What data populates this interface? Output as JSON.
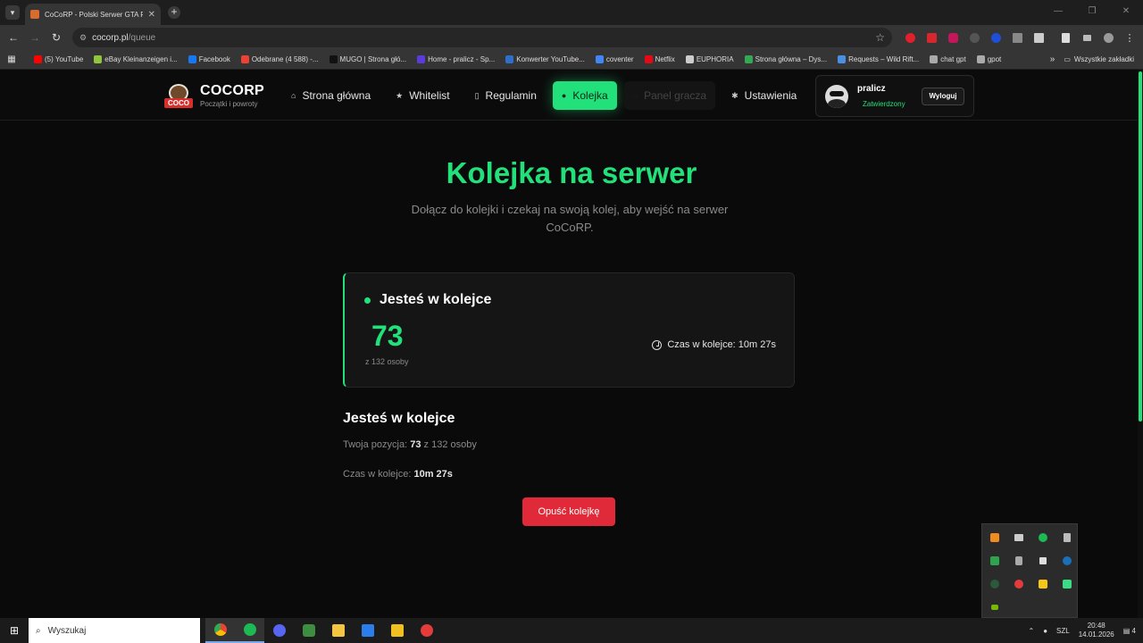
{
  "browser": {
    "tab_title": "CoCoRP - Polski Serwer GTA RP",
    "url_host": "cocorp.pl",
    "url_path": "/queue",
    "bookmarks": [
      {
        "label": "(5) YouTube",
        "color": "#ff0000"
      },
      {
        "label": "eBay Kleinanzeigen i...",
        "color": "#8ec63f"
      },
      {
        "label": "Facebook",
        "color": "#1877f2"
      },
      {
        "label": "Odebrane (4 588) -...",
        "color": "#ea4335"
      },
      {
        "label": "MUGO | Strona głó...",
        "color": "#111111"
      },
      {
        "label": "Home - pralicz - Sp...",
        "color": "#5b3bdb"
      },
      {
        "label": "Konwerter YouTube...",
        "color": "#2d6fc9"
      },
      {
        "label": "coventer",
        "color": "#4285f4"
      },
      {
        "label": "Netflix",
        "color": "#e50914"
      },
      {
        "label": "EUPHORIA",
        "color": "#cccccc"
      },
      {
        "label": "Strona główna – Dys...",
        "color": "#34a853"
      },
      {
        "label": "Requests – Wild Rift...",
        "color": "#4a90e2"
      },
      {
        "label": "chat gpt",
        "color": "#aaaaaa"
      },
      {
        "label": "gpot",
        "color": "#aaaaaa"
      }
    ],
    "all_bookmarks": "Wszystkie zakładki"
  },
  "brand": {
    "name": "COCORP",
    "tagline": "Początki i powroty",
    "logo_text": "COCO",
    "accent": "#22e07a"
  },
  "nav": {
    "items": [
      {
        "label": "Strona główna",
        "icon": "home-icon"
      },
      {
        "label": "Whitelist",
        "icon": "star-icon"
      },
      {
        "label": "Regulamin",
        "icon": "document-icon"
      },
      {
        "label": "Kolejka",
        "icon": "user-icon",
        "active": true
      },
      {
        "label": "Panel gracza",
        "icon": "loader-icon",
        "disabled": true
      },
      {
        "label": "Ustawienia",
        "icon": "gear-icon"
      }
    ]
  },
  "user": {
    "name": "pralicz",
    "status": "Zatwierdzony",
    "logout_label": "Wyloguj"
  },
  "page": {
    "title": "Kolejka na serwer",
    "subtitle": "Dołącz do kolejki i czekaj na swoją kolej, aby wejść na serwer CoCoRP."
  },
  "queue": {
    "status_label": "Jesteś w kolejce",
    "position": "73",
    "of_text": "z 132 osoby",
    "time_label": "Czas w kolejce: 10m 27s"
  },
  "details": {
    "title": "Jesteś w kolejce",
    "position_prefix": "Twoja pozycja:",
    "position_value": "73",
    "position_suffix": "z 132 osoby",
    "time_prefix": "Czas w kolejce:",
    "time_value": "10m 27s"
  },
  "leave_button": "Opuść kolejkę",
  "taskbar": {
    "search_placeholder": "Wyszukaj",
    "lang": "SZL",
    "time": "20:48",
    "date": "14.01.2026",
    "notifications": "4"
  }
}
